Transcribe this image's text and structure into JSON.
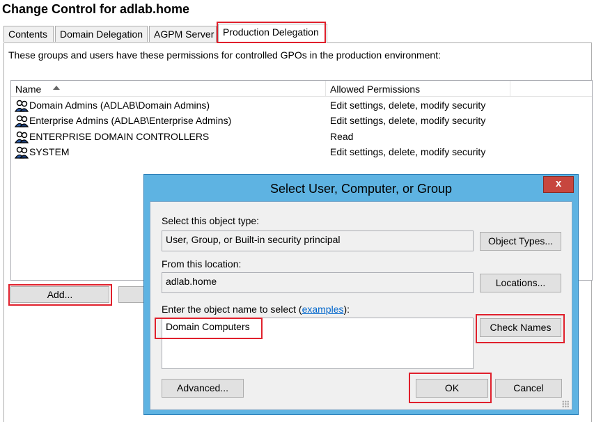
{
  "window": {
    "title": "Change Control for adlab.home"
  },
  "tabs": [
    {
      "label": "Contents"
    },
    {
      "label": "Domain Delegation"
    },
    {
      "label": "AGPM Server"
    },
    {
      "label": "Production Delegation"
    }
  ],
  "main": {
    "description": "These groups and users have these permissions for controlled GPOs in the production environment:",
    "columns": [
      {
        "label": "Name"
      },
      {
        "label": "Allowed Permissions"
      }
    ],
    "rows": [
      {
        "name": "Domain Admins (ADLAB\\Domain Admins)",
        "permissions": "Edit settings, delete, modify security"
      },
      {
        "name": "Enterprise Admins (ADLAB\\Enterprise Admins)",
        "permissions": "Edit settings, delete, modify security"
      },
      {
        "name": "ENTERPRISE DOMAIN CONTROLLERS",
        "permissions": "Read"
      },
      {
        "name": "SYSTEM",
        "permissions": "Edit settings, delete, modify security"
      }
    ],
    "add_button": "Add..."
  },
  "dialog": {
    "title": "Select User, Computer, or Group",
    "close_label": "x",
    "object_type_label": "Select this object type:",
    "object_type_value": "User, Group, or Built-in security principal",
    "object_types_button": "Object Types...",
    "location_label": "From this location:",
    "location_value": "adlab.home",
    "locations_button": "Locations...",
    "enter_label_prefix": "Enter the object name to select (",
    "enter_label_link": "examples",
    "enter_label_suffix": "):",
    "object_name_value": "Domain Computers",
    "check_names_button": "Check Names",
    "advanced_button": "Advanced...",
    "ok_button": "OK",
    "cancel_button": "Cancel"
  },
  "colors": {
    "highlight": "#e0202c",
    "dialog_frame": "#5eb3e2",
    "close_button": "#c7463e",
    "link": "#0066cc"
  },
  "icons": {
    "principal": "group-users-icon",
    "sort": "sort-ascending-icon"
  }
}
